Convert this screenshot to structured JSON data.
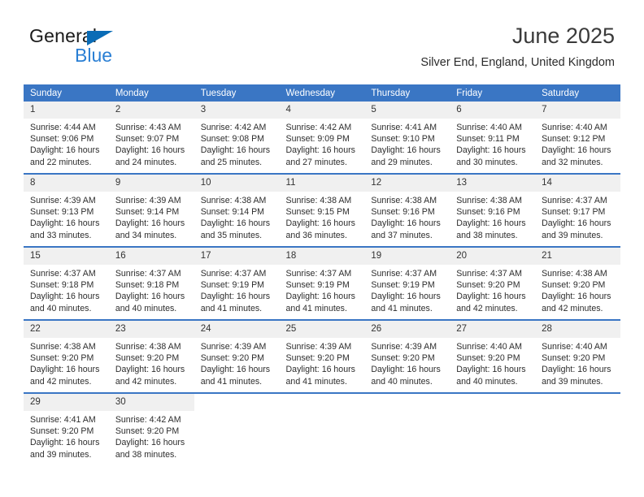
{
  "brand": {
    "name_part1": "General",
    "name_part2": "Blue",
    "triangle_color": "#0a6cb6",
    "blue_text_color": "#2a7fd4"
  },
  "header": {
    "title": "June 2025",
    "subtitle": "Silver End, England, United Kingdom"
  },
  "theme": {
    "header_row_bg": "#3a76c4",
    "header_row_text": "#ffffff",
    "daynum_bg": "#f0f0f0",
    "cell_divider": "#3a76c4"
  },
  "calendar": {
    "weekday_headers": [
      "Sunday",
      "Monday",
      "Tuesday",
      "Wednesday",
      "Thursday",
      "Friday",
      "Saturday"
    ],
    "weeks": [
      [
        {
          "day": "1",
          "sunrise": "Sunrise: 4:44 AM",
          "sunset": "Sunset: 9:06 PM",
          "daylight_line1": "Daylight: 16 hours",
          "daylight_line2": "and 22 minutes."
        },
        {
          "day": "2",
          "sunrise": "Sunrise: 4:43 AM",
          "sunset": "Sunset: 9:07 PM",
          "daylight_line1": "Daylight: 16 hours",
          "daylight_line2": "and 24 minutes."
        },
        {
          "day": "3",
          "sunrise": "Sunrise: 4:42 AM",
          "sunset": "Sunset: 9:08 PM",
          "daylight_line1": "Daylight: 16 hours",
          "daylight_line2": "and 25 minutes."
        },
        {
          "day": "4",
          "sunrise": "Sunrise: 4:42 AM",
          "sunset": "Sunset: 9:09 PM",
          "daylight_line1": "Daylight: 16 hours",
          "daylight_line2": "and 27 minutes."
        },
        {
          "day": "5",
          "sunrise": "Sunrise: 4:41 AM",
          "sunset": "Sunset: 9:10 PM",
          "daylight_line1": "Daylight: 16 hours",
          "daylight_line2": "and 29 minutes."
        },
        {
          "day": "6",
          "sunrise": "Sunrise: 4:40 AM",
          "sunset": "Sunset: 9:11 PM",
          "daylight_line1": "Daylight: 16 hours",
          "daylight_line2": "and 30 minutes."
        },
        {
          "day": "7",
          "sunrise": "Sunrise: 4:40 AM",
          "sunset": "Sunset: 9:12 PM",
          "daylight_line1": "Daylight: 16 hours",
          "daylight_line2": "and 32 minutes."
        }
      ],
      [
        {
          "day": "8",
          "sunrise": "Sunrise: 4:39 AM",
          "sunset": "Sunset: 9:13 PM",
          "daylight_line1": "Daylight: 16 hours",
          "daylight_line2": "and 33 minutes."
        },
        {
          "day": "9",
          "sunrise": "Sunrise: 4:39 AM",
          "sunset": "Sunset: 9:14 PM",
          "daylight_line1": "Daylight: 16 hours",
          "daylight_line2": "and 34 minutes."
        },
        {
          "day": "10",
          "sunrise": "Sunrise: 4:38 AM",
          "sunset": "Sunset: 9:14 PM",
          "daylight_line1": "Daylight: 16 hours",
          "daylight_line2": "and 35 minutes."
        },
        {
          "day": "11",
          "sunrise": "Sunrise: 4:38 AM",
          "sunset": "Sunset: 9:15 PM",
          "daylight_line1": "Daylight: 16 hours",
          "daylight_line2": "and 36 minutes."
        },
        {
          "day": "12",
          "sunrise": "Sunrise: 4:38 AM",
          "sunset": "Sunset: 9:16 PM",
          "daylight_line1": "Daylight: 16 hours",
          "daylight_line2": "and 37 minutes."
        },
        {
          "day": "13",
          "sunrise": "Sunrise: 4:38 AM",
          "sunset": "Sunset: 9:16 PM",
          "daylight_line1": "Daylight: 16 hours",
          "daylight_line2": "and 38 minutes."
        },
        {
          "day": "14",
          "sunrise": "Sunrise: 4:37 AM",
          "sunset": "Sunset: 9:17 PM",
          "daylight_line1": "Daylight: 16 hours",
          "daylight_line2": "and 39 minutes."
        }
      ],
      [
        {
          "day": "15",
          "sunrise": "Sunrise: 4:37 AM",
          "sunset": "Sunset: 9:18 PM",
          "daylight_line1": "Daylight: 16 hours",
          "daylight_line2": "and 40 minutes."
        },
        {
          "day": "16",
          "sunrise": "Sunrise: 4:37 AM",
          "sunset": "Sunset: 9:18 PM",
          "daylight_line1": "Daylight: 16 hours",
          "daylight_line2": "and 40 minutes."
        },
        {
          "day": "17",
          "sunrise": "Sunrise: 4:37 AM",
          "sunset": "Sunset: 9:19 PM",
          "daylight_line1": "Daylight: 16 hours",
          "daylight_line2": "and 41 minutes."
        },
        {
          "day": "18",
          "sunrise": "Sunrise: 4:37 AM",
          "sunset": "Sunset: 9:19 PM",
          "daylight_line1": "Daylight: 16 hours",
          "daylight_line2": "and 41 minutes."
        },
        {
          "day": "19",
          "sunrise": "Sunrise: 4:37 AM",
          "sunset": "Sunset: 9:19 PM",
          "daylight_line1": "Daylight: 16 hours",
          "daylight_line2": "and 41 minutes."
        },
        {
          "day": "20",
          "sunrise": "Sunrise: 4:37 AM",
          "sunset": "Sunset: 9:20 PM",
          "daylight_line1": "Daylight: 16 hours",
          "daylight_line2": "and 42 minutes."
        },
        {
          "day": "21",
          "sunrise": "Sunrise: 4:38 AM",
          "sunset": "Sunset: 9:20 PM",
          "daylight_line1": "Daylight: 16 hours",
          "daylight_line2": "and 42 minutes."
        }
      ],
      [
        {
          "day": "22",
          "sunrise": "Sunrise: 4:38 AM",
          "sunset": "Sunset: 9:20 PM",
          "daylight_line1": "Daylight: 16 hours",
          "daylight_line2": "and 42 minutes."
        },
        {
          "day": "23",
          "sunrise": "Sunrise: 4:38 AM",
          "sunset": "Sunset: 9:20 PM",
          "daylight_line1": "Daylight: 16 hours",
          "daylight_line2": "and 42 minutes."
        },
        {
          "day": "24",
          "sunrise": "Sunrise: 4:39 AM",
          "sunset": "Sunset: 9:20 PM",
          "daylight_line1": "Daylight: 16 hours",
          "daylight_line2": "and 41 minutes."
        },
        {
          "day": "25",
          "sunrise": "Sunrise: 4:39 AM",
          "sunset": "Sunset: 9:20 PM",
          "daylight_line1": "Daylight: 16 hours",
          "daylight_line2": "and 41 minutes."
        },
        {
          "day": "26",
          "sunrise": "Sunrise: 4:39 AM",
          "sunset": "Sunset: 9:20 PM",
          "daylight_line1": "Daylight: 16 hours",
          "daylight_line2": "and 40 minutes."
        },
        {
          "day": "27",
          "sunrise": "Sunrise: 4:40 AM",
          "sunset": "Sunset: 9:20 PM",
          "daylight_line1": "Daylight: 16 hours",
          "daylight_line2": "and 40 minutes."
        },
        {
          "day": "28",
          "sunrise": "Sunrise: 4:40 AM",
          "sunset": "Sunset: 9:20 PM",
          "daylight_line1": "Daylight: 16 hours",
          "daylight_line2": "and 39 minutes."
        }
      ],
      [
        {
          "day": "29",
          "sunrise": "Sunrise: 4:41 AM",
          "sunset": "Sunset: 9:20 PM",
          "daylight_line1": "Daylight: 16 hours",
          "daylight_line2": "and 39 minutes."
        },
        {
          "day": "30",
          "sunrise": "Sunrise: 4:42 AM",
          "sunset": "Sunset: 9:20 PM",
          "daylight_line1": "Daylight: 16 hours",
          "daylight_line2": "and 38 minutes."
        },
        {
          "day": "",
          "sunrise": "",
          "sunset": "",
          "daylight_line1": "",
          "daylight_line2": ""
        },
        {
          "day": "",
          "sunrise": "",
          "sunset": "",
          "daylight_line1": "",
          "daylight_line2": ""
        },
        {
          "day": "",
          "sunrise": "",
          "sunset": "",
          "daylight_line1": "",
          "daylight_line2": ""
        },
        {
          "day": "",
          "sunrise": "",
          "sunset": "",
          "daylight_line1": "",
          "daylight_line2": ""
        },
        {
          "day": "",
          "sunrise": "",
          "sunset": "",
          "daylight_line1": "",
          "daylight_line2": ""
        }
      ]
    ]
  }
}
